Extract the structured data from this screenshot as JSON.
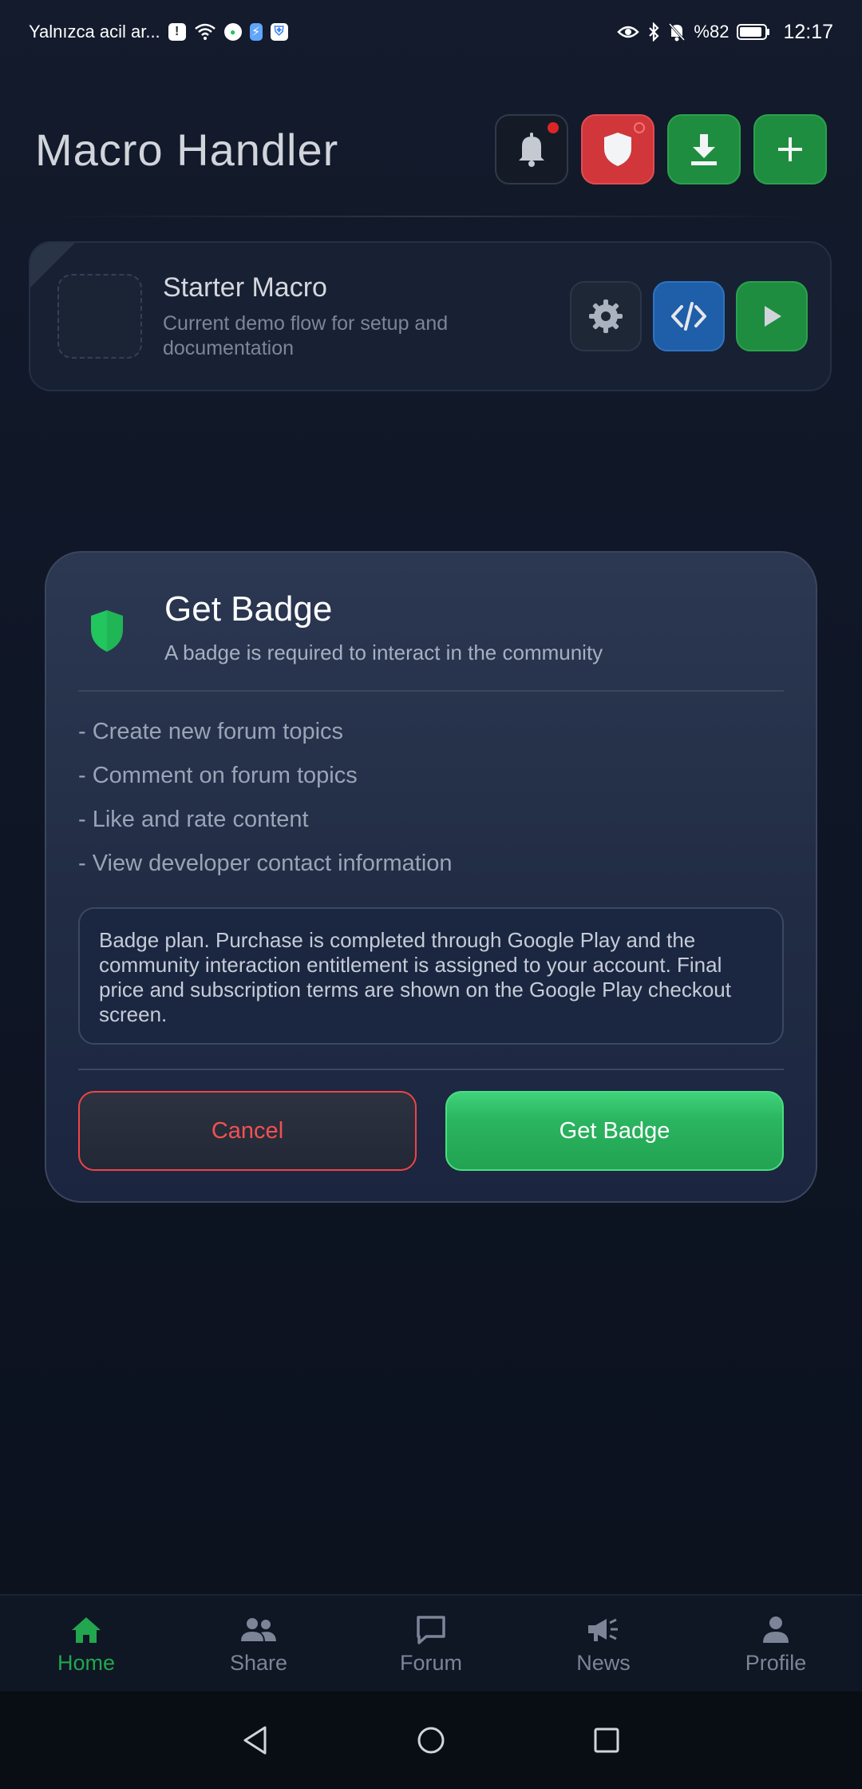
{
  "status_bar": {
    "carrier": "Yalnızca acil ar...",
    "battery": "%82",
    "time": "12:17"
  },
  "header": {
    "app_title": "Macro Handler",
    "buttons": [
      {
        "icon": "bell-icon",
        "has_badge": true
      },
      {
        "icon": "shield-icon",
        "color": "#d0363a"
      },
      {
        "icon": "download-icon",
        "color": "#1f8d3f"
      },
      {
        "icon": "plus-icon",
        "color": "#1f8d3f"
      }
    ]
  },
  "macro_card": {
    "title": "Starter Macro",
    "subtitle": "Current demo flow for setup and documentation",
    "actions": [
      "gear-icon",
      "code-icon",
      "play-icon"
    ]
  },
  "modal": {
    "title": "Get Badge",
    "subtitle": "A badge is required to interact in the community",
    "features": [
      "- Create new forum topics",
      "- Comment on forum topics",
      "- Like and rate content",
      "- View developer contact information"
    ],
    "info": "Badge plan. Purchase is completed through Google Play and the community interaction entitlement is assigned to your account. Final price and subscription terms are shown on the Google Play checkout screen.",
    "cancel_label": "Cancel",
    "confirm_label": "Get Badge",
    "accent_color": "#22c55e",
    "danger_color": "#ef4444"
  },
  "bottom_nav": {
    "items": [
      {
        "label": "Home",
        "icon": "home-icon",
        "active": true
      },
      {
        "label": "Share",
        "icon": "people-icon",
        "active": false
      },
      {
        "label": "Forum",
        "icon": "chat-bubble-icon",
        "active": false
      },
      {
        "label": "News",
        "icon": "megaphone-icon",
        "active": false
      },
      {
        "label": "Profile",
        "icon": "person-icon",
        "active": false
      }
    ]
  }
}
